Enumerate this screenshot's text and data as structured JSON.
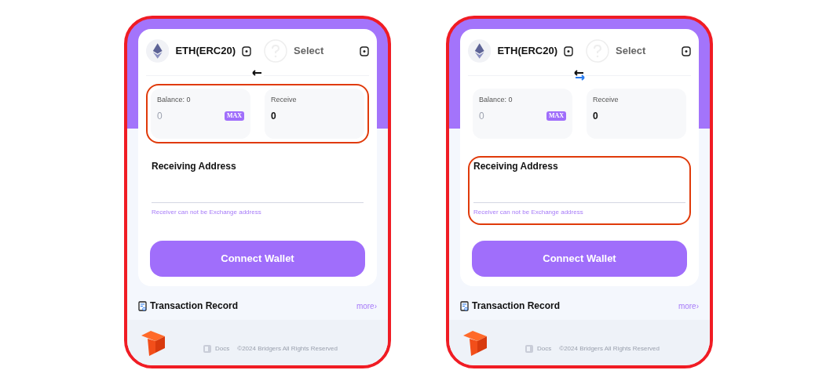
{
  "phones": [
    {
      "amounts_highlighted": true,
      "address_highlighted": false,
      "from_token": "ETH(ERC20)",
      "to_token": "Select",
      "balance_label": "Balance:  0",
      "amount_placeholder": "0",
      "max_label": "MAX",
      "receive_label": "Receive",
      "receive_value": "0",
      "address_label": "Receiving Address",
      "address_hint": "Receiver can not be Exchange address",
      "connect_button": "Connect Wallet",
      "record_title": "Transaction Record",
      "more_link": "more›",
      "docs_link": "Docs",
      "copyright": "©2024 Bridgers All Rights Reserved"
    },
    {
      "amounts_highlighted": false,
      "address_highlighted": true,
      "from_token": "ETH(ERC20)",
      "to_token": "Select",
      "balance_label": "Balance:  0",
      "amount_placeholder": "0",
      "max_label": "MAX",
      "receive_label": "Receive",
      "receive_value": "0",
      "address_label": "Receiving Address",
      "address_hint": "Receiver can not be Exchange address",
      "connect_button": "Connect Wallet",
      "record_title": "Transaction Record",
      "more_link": "more›",
      "docs_link": "Docs",
      "copyright": "©2024 Bridgers All Rights Reserved"
    }
  ]
}
